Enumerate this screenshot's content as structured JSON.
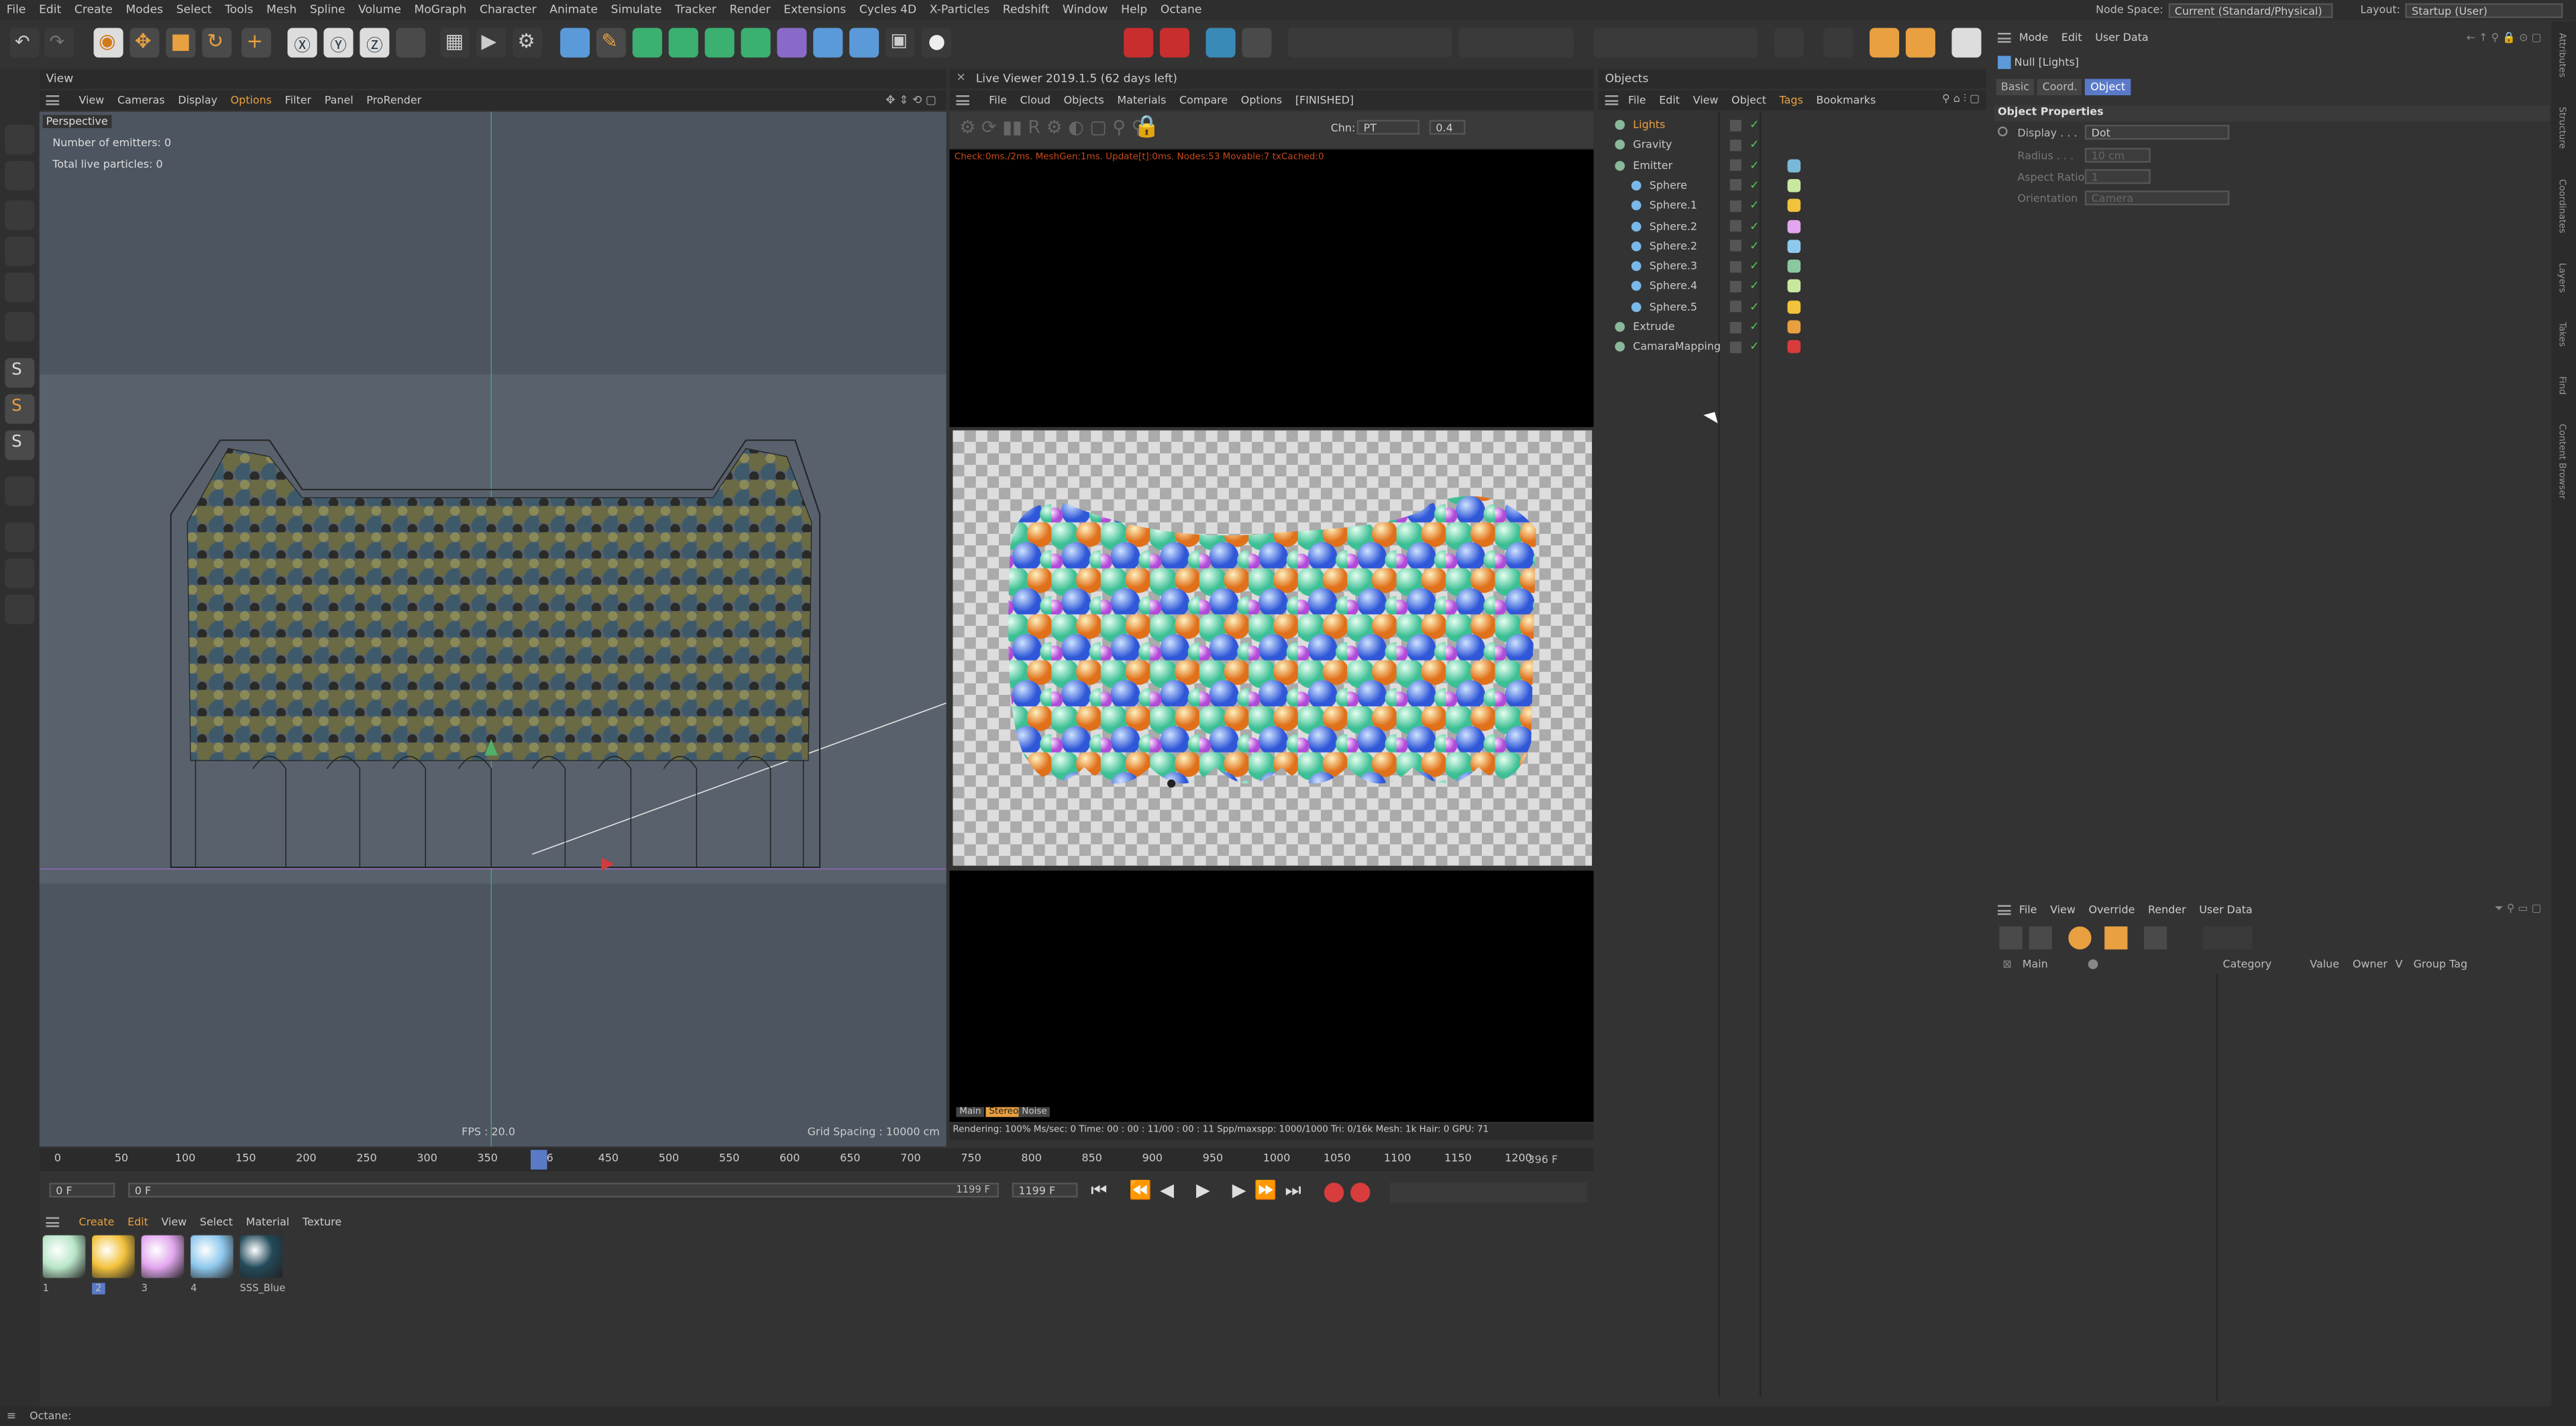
{
  "menu": [
    "File",
    "Edit",
    "Create",
    "Modes",
    "Select",
    "Tools",
    "Mesh",
    "Spline",
    "Volume",
    "MoGraph",
    "Character",
    "Animate",
    "Simulate",
    "Tracker",
    "Render",
    "Extensions",
    "Cycles 4D",
    "X-Particles",
    "Redshift",
    "Window",
    "Help",
    "Octane"
  ],
  "node_space": {
    "label": "Node Space:",
    "value": "Current (Standard/Physical)"
  },
  "layout": {
    "label": "Layout:",
    "value": "Startup (User)"
  },
  "viewport": {
    "panel_title": "View",
    "menu": [
      "View",
      "Cameras",
      "Display",
      "Options",
      "Filter",
      "Panel",
      "ProRender"
    ],
    "camera": "Perspective",
    "emitters": "Number of emitters: 0",
    "particles": "Total live particles: 0",
    "fps": "FPS : 20.0",
    "grid": "Grid Spacing : 10000 cm"
  },
  "live_viewer": {
    "title": "Live Viewer 2019.1.5 (62 days left)",
    "menu": [
      "File",
      "Cloud",
      "Objects",
      "Materials",
      "Compare",
      "Options",
      "[FINISHED]"
    ],
    "chn_label": "Chn:",
    "chn_value": "PT",
    "chn_num": "0.4",
    "stats_line": "Check:0ms./2ms. MeshGen:1ms. Update[t]:0ms. Nodes:53 Movable:7 txCached:0",
    "bottom_tabs": [
      "Main",
      "Stereo",
      "Noise"
    ],
    "status": "Rendering: 100%  Ms/sec: 0    Time: 00 : 00 : 11/00 : 00 : 11    Spp/maxspp: 1000/1000    Tri: 0/16k    Mesh: 1k    Hair: 0    GPU:    71"
  },
  "objects": {
    "panel_title": "Objects",
    "menu": [
      "File",
      "Edit",
      "View",
      "Object",
      "Tags",
      "Bookmarks"
    ],
    "items": [
      {
        "name": "Lights",
        "color": "#e8a040"
      },
      {
        "name": "Gravity",
        "color": "#c8c8c8"
      },
      {
        "name": "Emitter",
        "color": "#c8c8c8"
      },
      {
        "name": "Sphere",
        "color": "#c8c8c8"
      },
      {
        "name": "Sphere.1",
        "color": "#c8c8c8"
      },
      {
        "name": "Sphere.2",
        "color": "#c8c8c8"
      },
      {
        "name": "Sphere.2",
        "color": "#c8c8c8"
      },
      {
        "name": "Sphere.3",
        "color": "#c8c8c8"
      },
      {
        "name": "Sphere.4",
        "color": "#c8c8c8"
      },
      {
        "name": "Sphere.5",
        "color": "#c8c8c8"
      },
      {
        "name": "Extrude",
        "color": "#c8c8c8"
      },
      {
        "name": "CamaraMapping",
        "color": "#c8c8c8"
      }
    ]
  },
  "attributes": {
    "menu": [
      "Mode",
      "Edit",
      "User Data"
    ],
    "object_title": "Null [Lights]",
    "tabs": [
      "Basic",
      "Coord.",
      "Object"
    ],
    "section": "Object Properties",
    "display_label": "Display . . .",
    "display_value": "Dot",
    "radius_label": "Radius . . .",
    "radius_value": "10 cm",
    "aspect_label": "Aspect Ratio",
    "aspect_value": "1",
    "orient_label": "Orientation",
    "orient_value": "Camera",
    "side_tabs": [
      "Attributes",
      "Structure",
      "Coordinates",
      "Layers",
      "Takes",
      "Find",
      "Content Browser"
    ]
  },
  "takes": {
    "menu": [
      "File",
      "View",
      "Override",
      "Render",
      "User Data"
    ],
    "main": "Main",
    "columns": [
      "Category",
      "Value",
      "Owner",
      "V",
      "Group Tag"
    ]
  },
  "timeline": {
    "ticks": [
      "0",
      "50",
      "100",
      "150",
      "200",
      "250",
      "300",
      "350",
      "396",
      "450",
      "500",
      "550",
      "600",
      "650",
      "700",
      "750",
      "800",
      "850",
      "900",
      "950",
      "1000",
      "1050",
      "1100",
      "1150",
      "1200"
    ],
    "frame_end_label": "396 F",
    "current_frame": "0 F",
    "start_field": "0 F",
    "end_field": "1199 F",
    "max_field": "1199 F",
    "playhead_frame": 396
  },
  "materials": {
    "menu": [
      "Create",
      "Edit",
      "View",
      "Select",
      "Material",
      "Texture"
    ],
    "items": [
      {
        "name": "1",
        "color": "#b8e6c8"
      },
      {
        "name": "2",
        "color": "#f2c23c"
      },
      {
        "name": "3",
        "color": "#e2a6ee"
      },
      {
        "name": "4",
        "color": "#8ec8ee"
      },
      {
        "name": "SSS_Blue",
        "color": "#234a5a"
      }
    ]
  },
  "statusbar": "Octane:",
  "colors": {
    "accent": "#e8a040",
    "bg": "#333333",
    "panel": "#2b2b2b"
  }
}
